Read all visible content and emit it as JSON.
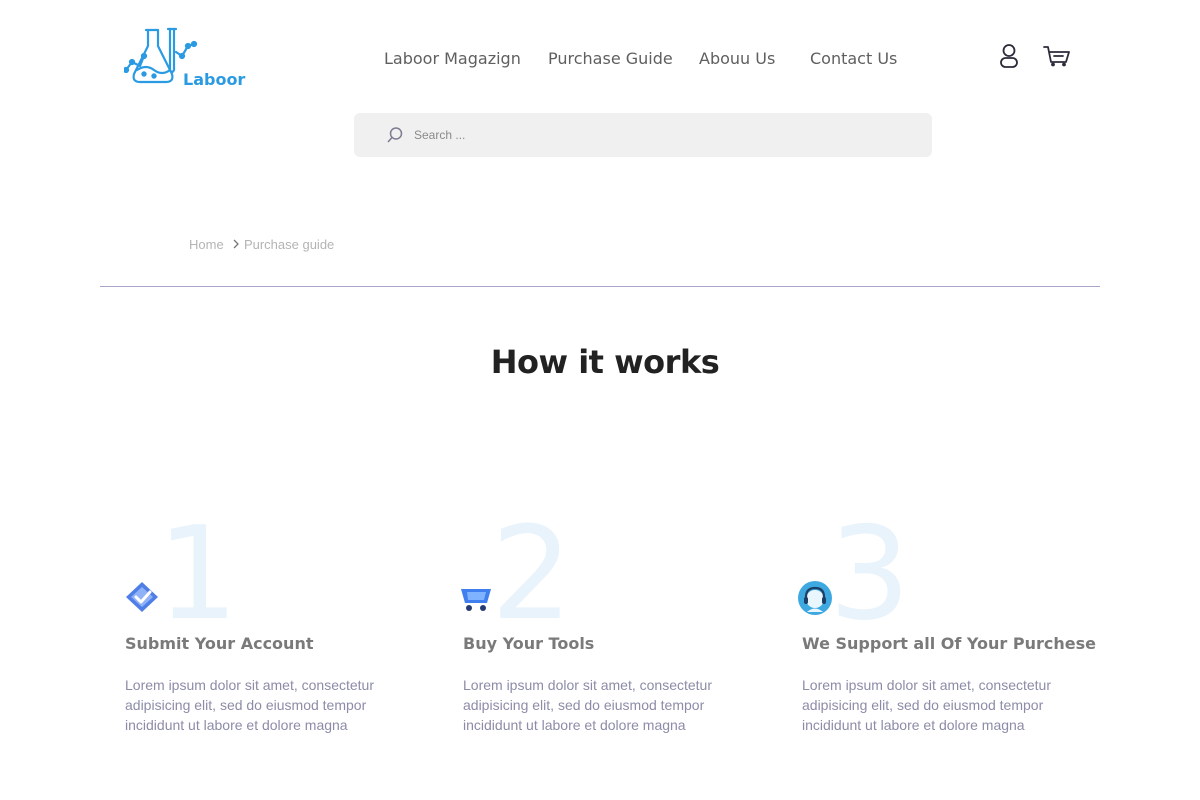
{
  "brand": {
    "name": "Laboor",
    "logo_icon": "lab-flask-icon",
    "accent_color": "#2a9be3"
  },
  "nav": {
    "items": [
      {
        "label": "Laboor Magazign"
      },
      {
        "label": "Purchase Guide"
      },
      {
        "label": "Abouu Us"
      },
      {
        "label": "Contact Us"
      }
    ]
  },
  "header_icons": {
    "account": "user-icon",
    "cart": "cart-icon"
  },
  "search": {
    "placeholder": "Search ...",
    "value": "",
    "icon": "search-icon"
  },
  "breadcrumb": {
    "home": "Home",
    "separator_icon": "chevron-right-icon",
    "current": "Purchase guide"
  },
  "how_it_works": {
    "title": "How it works",
    "steps": [
      {
        "number": "1",
        "icon": "layers-check-icon",
        "title": "Submit Your Account",
        "description": "Lorem ipsum dolor sit amet, consectetur adipisicing elit, sed do eiusmod tempor incididunt ut labore et dolore magna"
      },
      {
        "number": "2",
        "icon": "shopping-cart-icon",
        "title": "Buy Your Tools",
        "description": "Lorem ipsum dolor sit amet, consectetur adipisicing elit, sed do eiusmod tempor incididunt ut labore et dolore magna"
      },
      {
        "number": "3",
        "icon": "headset-support-icon",
        "title": "We Support  all Of  Your Purchese",
        "description": "Lorem ipsum dolor sit amet, consectetur adipisicing elit, sed do eiusmod tempor incididunt ut labore et dolore magna"
      }
    ]
  }
}
